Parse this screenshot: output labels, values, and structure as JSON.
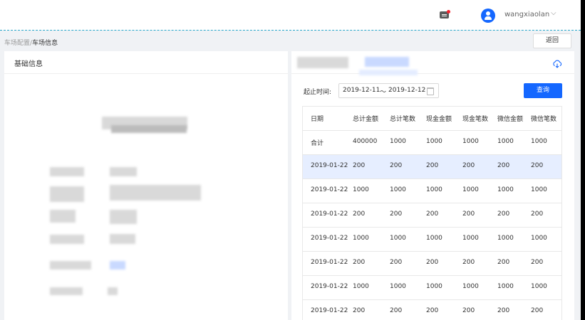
{
  "header": {
    "username": "wangxiaolan",
    "chevron": "⌵",
    "icons": [
      "message-icon",
      "user-avatar-icon",
      "chevron-down-icon"
    ]
  },
  "breadcrumb": {
    "parent": "车场配置",
    "separator": "/",
    "current": "车场信息"
  },
  "back_button": "返回",
  "left_card": {
    "title": "基础信息"
  },
  "right_card": {
    "download_icon": "cloud-download-icon",
    "date_label": "起止时间:",
    "date_start": "2019-12-11",
    "date_separator": "～",
    "date_end": "2019-12-12",
    "query_button": "查询",
    "accent_color": "#1467ff",
    "highlight_row_color": "#e6eeff"
  },
  "table": {
    "columns": [
      "日期",
      "总计金额",
      "总计笔数",
      "现金金额",
      "现金笔数",
      "微信金额",
      "微信笔数"
    ],
    "rows": [
      [
        "合计",
        "400000",
        "1000",
        "1000",
        "1000",
        "1000",
        "1000"
      ],
      [
        "2019-01-22",
        "200",
        "200",
        "200",
        "200",
        "200",
        "200"
      ],
      [
        "2019-01-22",
        "1000",
        "1000",
        "1000",
        "1000",
        "1000",
        "1000"
      ],
      [
        "2019-01-22",
        "200",
        "200",
        "200",
        "200",
        "200",
        "200"
      ],
      [
        "2019-01-22",
        "1000",
        "1000",
        "1000",
        "1000",
        "1000",
        "1000"
      ],
      [
        "2019-01-22",
        "200",
        "200",
        "200",
        "200",
        "200",
        "200"
      ],
      [
        "2019-01-22",
        "1000",
        "1000",
        "1000",
        "1000",
        "1000",
        "1000"
      ],
      [
        "2019-01-22",
        "200",
        "200",
        "200",
        "200",
        "200",
        "200"
      ]
    ],
    "highlighted_row": 1
  }
}
